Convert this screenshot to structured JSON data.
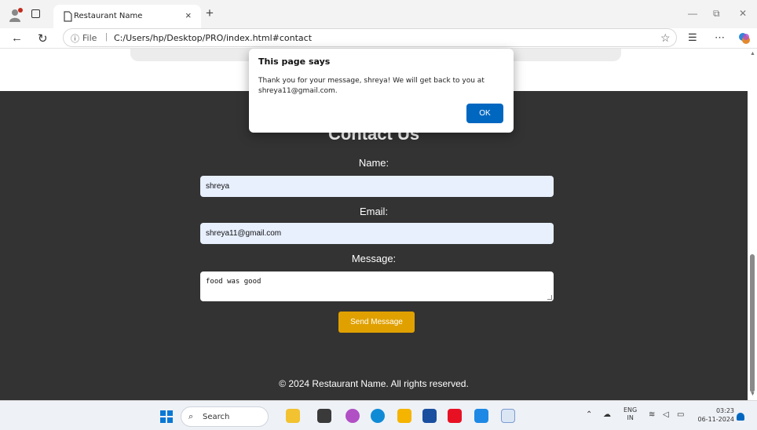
{
  "browser": {
    "tab_title": "Restaurant Name",
    "tab_close": "×",
    "new_tab": "+",
    "address_label": "File",
    "url": "C:/Users/hp/Desktop/PRO/index.html#contact",
    "window_controls": {
      "minimize": "—",
      "restore": "⧉",
      "close": "✕"
    }
  },
  "page": {
    "heading": "Contact Us",
    "name_label": "Name:",
    "name_value": "shreya",
    "email_label": "Email:",
    "email_value": "shreya11@gmail.com",
    "message_label": "Message:",
    "message_value": "food was good",
    "send_button": "Send Message",
    "footer": "© 2024 Restaurant Name. All rights reserved."
  },
  "dialog": {
    "title": "This page says",
    "message": "Thank you for your message, shreya! We will get back to you at shreya11@gmail.com.",
    "ok": "OK"
  },
  "taskbar": {
    "search_label": "Search",
    "lang_line1": "ENG",
    "lang_line2": "IN",
    "time": "03:23",
    "date": "06-11-2024"
  },
  "colors": {
    "page_dark": "#333333",
    "button": "#e0a100",
    "dialog_ok": "#0067c0"
  }
}
